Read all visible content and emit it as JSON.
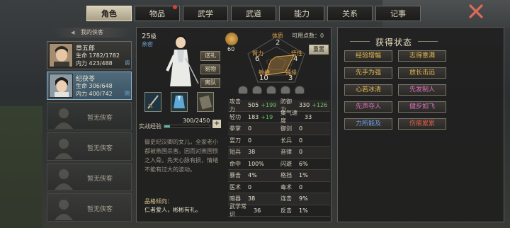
{
  "tabs": [
    {
      "label": "角色",
      "active": true
    },
    {
      "label": "物品",
      "badge": true
    },
    {
      "label": "武学"
    },
    {
      "label": "武道"
    },
    {
      "label": "能力"
    },
    {
      "label": "关系"
    },
    {
      "label": "记事"
    }
  ],
  "left_panel": {
    "title": "我的侠客",
    "heroes": [
      {
        "name": "章五郎",
        "hp": "生命 1782/1782",
        "mp": "内力 423/488",
        "tag": "调"
      },
      {
        "name": "纪茯苓",
        "hp": "生命 306/648",
        "mp": "内力 400/742",
        "tag": "阴"
      }
    ],
    "empty_label": "暂无侠客"
  },
  "character": {
    "level": "25",
    "level_unit": "级",
    "title": "亲密",
    "buttons": [
      "送礼",
      "易物",
      "离队"
    ],
    "medal_value": "60",
    "free_points_label": "可用点数：0",
    "reset_label": "重置",
    "attrs": [
      {
        "label": "体质",
        "value": "2"
      },
      {
        "label": "臂力",
        "value": "6"
      },
      {
        "label": "悟性",
        "value": "4"
      },
      {
        "label": "敏捷",
        "value": "10"
      },
      {
        "label": "福缘",
        "value": "3"
      }
    ],
    "exp_label": "实战经验",
    "exp_value": "300/2450",
    "exp_fraction": 0.12,
    "bio": "御史纪汉卿的女儿，全家老小都被燕国杀害。因而对燕国恨之入骨。先天心脉有损，情绪不能有过大的波动。",
    "trait_title": "品格倾向：",
    "trait_value": "仁者爱人，彬彬有礼。"
  },
  "stats": [
    [
      {
        "k": "攻击力",
        "v": "505",
        "b": "+199"
      },
      {
        "k": "防御力",
        "v": "330",
        "b": "+126"
      }
    ],
    [
      {
        "k": "轻功",
        "v": "183",
        "b": "+19"
      },
      {
        "k": "集气速度",
        "v": "33"
      }
    ],
    [
      {
        "k": "拳掌",
        "v": "0"
      },
      {
        "k": "御剑",
        "v": "0"
      }
    ],
    [
      {
        "k": "耍刀",
        "v": "0"
      },
      {
        "k": "长兵",
        "v": "0"
      }
    ],
    [
      {
        "k": "短兵",
        "v": "38"
      },
      {
        "k": "音律",
        "v": "0"
      }
    ],
    [
      {
        "k": "命中",
        "v": "100%"
      },
      {
        "k": "闪避",
        "v": "6%"
      }
    ],
    [
      {
        "k": "暴击",
        "v": "4%"
      },
      {
        "k": "格挡",
        "v": "1%"
      }
    ],
    [
      {
        "k": "医术",
        "v": "0"
      },
      {
        "k": "毒术",
        "v": "0"
      }
    ],
    [
      {
        "k": "暗器",
        "v": "38"
      },
      {
        "k": "连击",
        "v": "9%"
      }
    ],
    [
      {
        "k": "武学常识",
        "v": "36"
      },
      {
        "k": "反击",
        "v": "1%"
      }
    ]
  ],
  "status_panel": {
    "title": "获得状态",
    "buffs": [
      {
        "label": "经验增幅",
        "color": "gold"
      },
      {
        "label": "志得意满",
        "color": "gold"
      },
      {
        "label": "先手为强",
        "color": "gold"
      },
      {
        "label": "放长击远",
        "color": "gold"
      },
      {
        "label": "心若冰清",
        "color": "gold"
      },
      {
        "label": "先发制人",
        "color": "pink"
      },
      {
        "label": "先声夺人",
        "color": "pink"
      },
      {
        "label": "健步如飞",
        "color": "pink"
      },
      {
        "label": "力所能及",
        "color": "blue"
      },
      {
        "label": "伤痕累累",
        "color": "red"
      }
    ]
  }
}
